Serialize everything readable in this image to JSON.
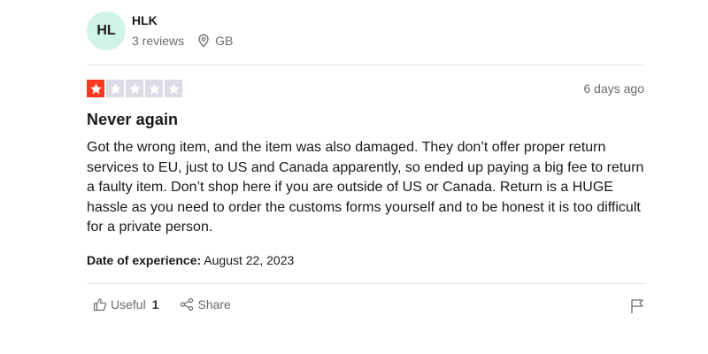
{
  "reviewer": {
    "initials": "HL",
    "name": "HLK",
    "reviews": "3 reviews",
    "country": "GB",
    "location_icon": "map-pin-icon"
  },
  "review": {
    "rating": 1,
    "rating_max": 5,
    "date": "6 days ago",
    "title": "Never again",
    "body": "Got the wrong item, and the item was also damaged. They don’t offer proper return services to EU, just to US and Canada apparently, so ended up paying a big fee to return a faulty item. Don’t shop here if you are outside of US or Canada. Return is a HUGE hassle as you need to order the customs forms yourself and to be honest it is too difficult for a private person.",
    "experience_label": "Date of experience:",
    "experience_date": "August 22, 2023"
  },
  "actions": {
    "useful_label": "Useful",
    "useful_count": "1",
    "share_label": "Share"
  },
  "colors": {
    "star_filled": "#ff3722",
    "star_empty": "#dcdce6",
    "avatar_bg": "#d0f4e6"
  },
  "icons": {
    "useful": "thumbs-up-icon",
    "share": "share-icon",
    "report": "flag-icon",
    "star": "star-icon"
  }
}
